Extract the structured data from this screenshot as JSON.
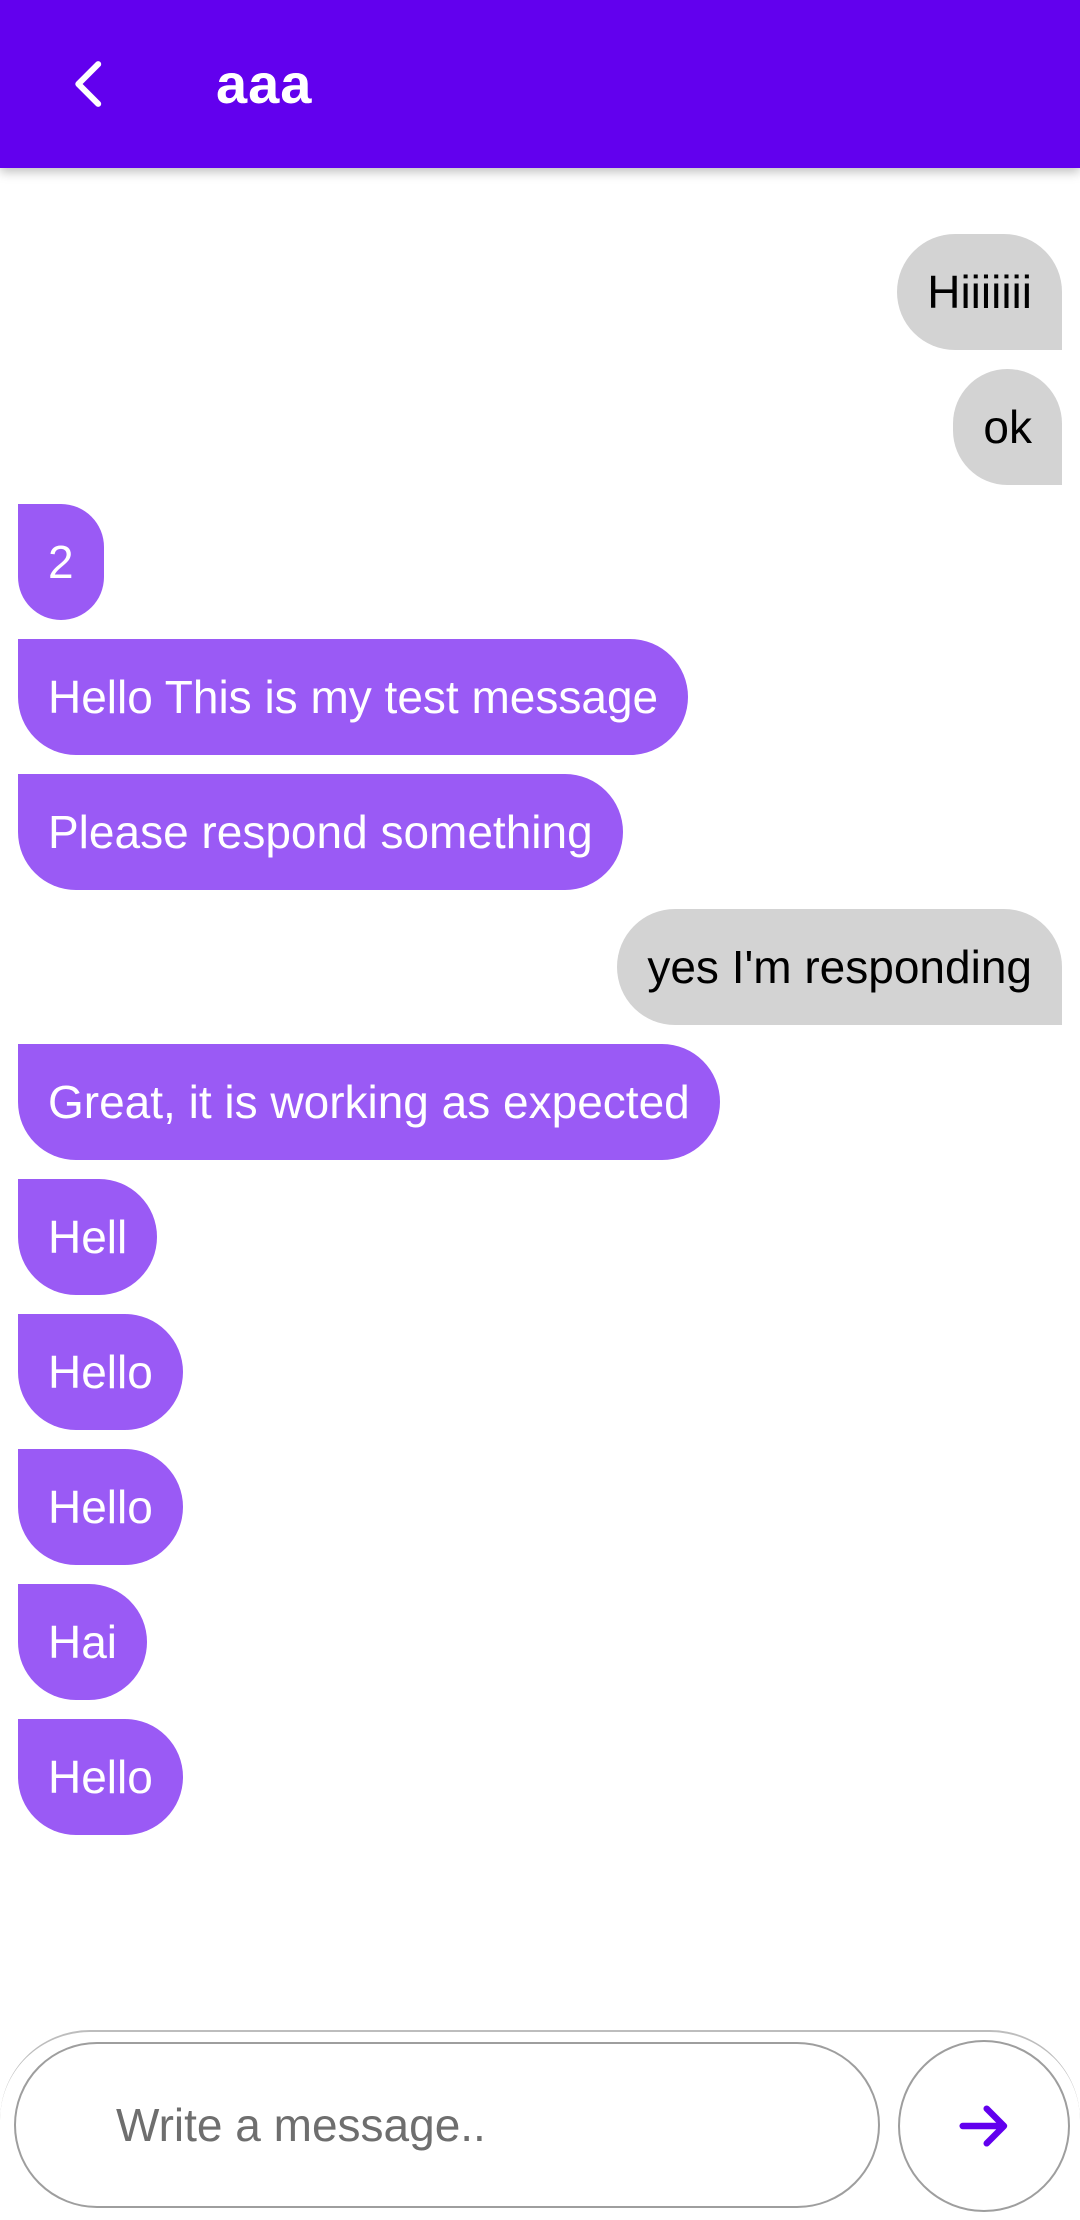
{
  "header": {
    "title": "aaa",
    "back_icon": "chevron-left-icon",
    "background_color": "#6200EE"
  },
  "messages": [
    {
      "direction": "sent",
      "text": "Hiiiiiii"
    },
    {
      "direction": "sent",
      "text": "ok"
    },
    {
      "direction": "received",
      "text": "2"
    },
    {
      "direction": "received",
      "text": "Hello This is my test message"
    },
    {
      "direction": "received",
      "text": "Please respond something"
    },
    {
      "direction": "sent",
      "text": "yes I'm responding"
    },
    {
      "direction": "received",
      "text": "Great, it is working as expected"
    },
    {
      "direction": "received",
      "text": "Hell"
    },
    {
      "direction": "received",
      "text": "Hello"
    },
    {
      "direction": "received",
      "text": "Hello"
    },
    {
      "direction": "received",
      "text": "Hai"
    },
    {
      "direction": "received",
      "text": "Hello"
    }
  ],
  "composer": {
    "placeholder": "Write a message..",
    "value": "",
    "send_icon": "arrow-right-icon"
  },
  "colors": {
    "sent_bubble": "#D3D3D3",
    "received_bubble": "#9A5AF5",
    "accent": "#6200EE"
  }
}
